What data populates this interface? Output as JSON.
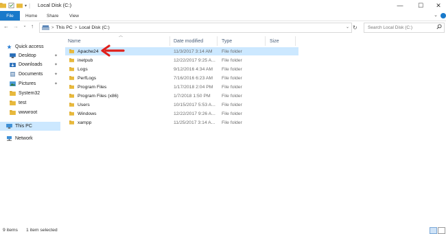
{
  "window": {
    "title": "Local Disk (C:)",
    "controls": {
      "minimize": "—",
      "maximize": "☐",
      "close": "✕"
    }
  },
  "ribbon": {
    "tabs": [
      "File",
      "Home",
      "Share",
      "View"
    ],
    "expand_icon": "chevron-down"
  },
  "address": {
    "back": "←",
    "forward": "→",
    "recent": "⌄",
    "up": "↑",
    "segments": [
      "This PC",
      "Local Disk (C:)"
    ],
    "separator": ">",
    "refresh": "↻"
  },
  "search": {
    "placeholder": "Search Local Disk (C:)"
  },
  "nav": {
    "items": [
      {
        "label": "Quick access",
        "icon": "star-icon",
        "pinned": false
      },
      {
        "label": "Desktop",
        "icon": "desktop-icon",
        "pinned": true
      },
      {
        "label": "Downloads",
        "icon": "download-icon",
        "pinned": true
      },
      {
        "label": "Documents",
        "icon": "document-icon",
        "pinned": true
      },
      {
        "label": "Pictures",
        "icon": "picture-icon",
        "pinned": true
      },
      {
        "label": "System32",
        "icon": "folder-icon",
        "pinned": false
      },
      {
        "label": "test",
        "icon": "folder-icon",
        "pinned": false
      },
      {
        "label": "wwwroot",
        "icon": "folder-icon",
        "pinned": false
      },
      {
        "label": "This PC",
        "icon": "computer-icon",
        "pinned": false
      },
      {
        "label": "Network",
        "icon": "network-icon",
        "pinned": false
      }
    ],
    "pin_glyph": "📌"
  },
  "columns": {
    "name": "Name",
    "date": "Date modified",
    "type": "Type",
    "size": "Size"
  },
  "files": [
    {
      "name": "Apache24",
      "date": "11/3/2017 3:14 AM",
      "type": "File folder",
      "selected": true
    },
    {
      "name": "inetpub",
      "date": "12/22/2017 9:25 A...",
      "type": "File folder"
    },
    {
      "name": "Logs",
      "date": "9/12/2016 4:34 AM",
      "type": "File folder"
    },
    {
      "name": "PerfLogs",
      "date": "7/16/2016 6:23 AM",
      "type": "File folder"
    },
    {
      "name": "Program Files",
      "date": "1/17/2018 2:04 PM",
      "type": "File folder"
    },
    {
      "name": "Program Files (x86)",
      "date": "1/7/2018 1:50 PM",
      "type": "File folder"
    },
    {
      "name": "Users",
      "date": "10/15/2017 5:53 A...",
      "type": "File folder"
    },
    {
      "name": "Windows",
      "date": "12/22/2017 9:26 A...",
      "type": "File folder"
    },
    {
      "name": "xampp",
      "date": "11/25/2017 3:14 A...",
      "type": "File folder"
    }
  ],
  "status": {
    "count": "9 items",
    "selection": "1 item selected"
  },
  "colors": {
    "accent": "#1979ca",
    "selection": "#cce8ff",
    "folder": "#e8b93c",
    "annotation": "#e0201b"
  }
}
